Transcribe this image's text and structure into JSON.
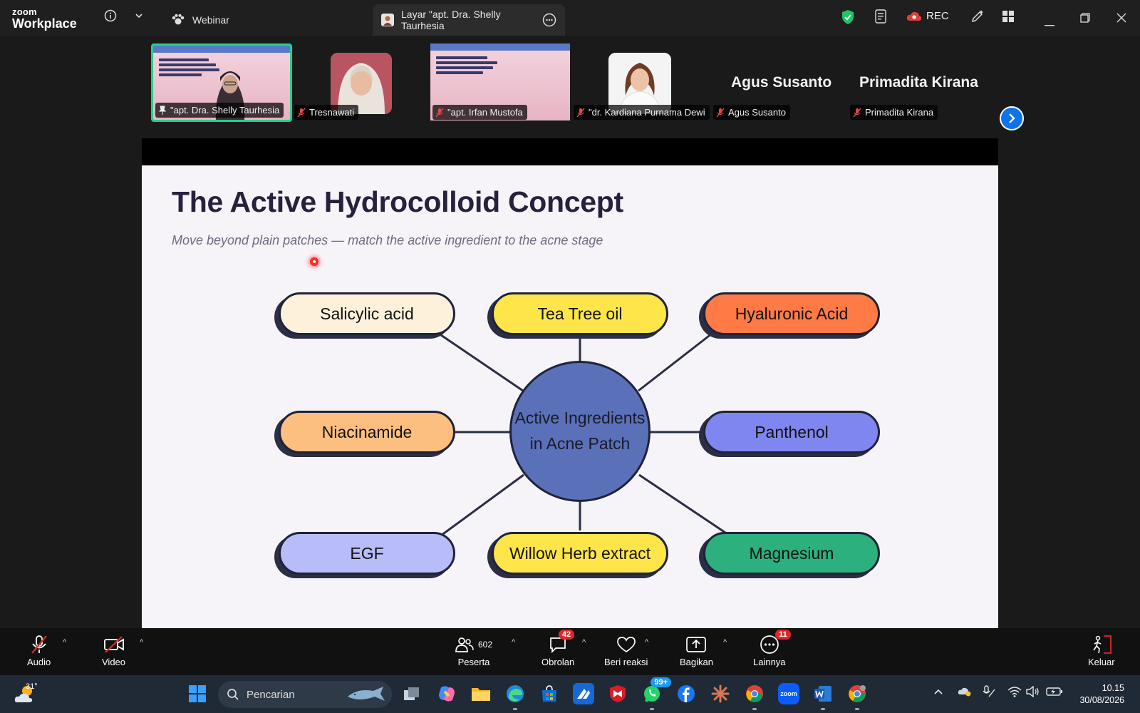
{
  "window": {
    "brand_line1": "zoom",
    "brand_line2": "Workplace",
    "tabs": [
      {
        "label": "Webinar"
      },
      {
        "label": "Layar \"apt. Dra. Shelly Taurhesia"
      }
    ],
    "rec_label": "REC"
  },
  "gallery": {
    "participants": [
      {
        "label": "\"apt. Dra. Shelly Taurhesia",
        "pinned": true,
        "muted": false
      },
      {
        "label": "Tresnawati",
        "muted": true
      },
      {
        "label": "\"apt. Irfan Mustofa",
        "muted": true
      },
      {
        "label": "\"dr. Kardiana Purnama Dewi",
        "muted": true
      },
      {
        "label": "Agus Susanto",
        "muted": true
      },
      {
        "label": "Primadita Kirana",
        "muted": true
      }
    ],
    "name_only": [
      "Agus Susanto",
      "Primadita Kirana"
    ]
  },
  "slide": {
    "title": "The Active Hydrocolloid Concept",
    "subtitle": "Move beyond plain patches — match the active ingredient to the acne stage",
    "hub": {
      "line1": "Active Ingredients",
      "line2": "in Acne Patch",
      "color": "#5a70b8"
    },
    "ingredients": [
      {
        "label": "Salicylic acid",
        "color": "#fdf1dc"
      },
      {
        "label": "Tea Tree oil",
        "color": "#fde54a"
      },
      {
        "label": "Hyaluronic Acid",
        "color": "#ff7a45"
      },
      {
        "label": "Niacinamide",
        "color": "#fdbf80"
      },
      {
        "label": "Panthenol",
        "color": "#7f86f0"
      },
      {
        "label": "EGF",
        "color": "#b8bcf8"
      },
      {
        "label": "Willow Herb extract",
        "color": "#fde54a"
      },
      {
        "label": "Magnesium",
        "color": "#2bb07e"
      }
    ]
  },
  "controls": {
    "audio": "Audio",
    "video": "Video",
    "participants": "Peserta",
    "participants_count": "602",
    "chat": "Obrolan",
    "chat_badge": "42",
    "react": "Beri reaksi",
    "share": "Bagikan",
    "more": "Lainnya",
    "more_badge": "11",
    "leave": "Keluar"
  },
  "taskbar": {
    "temperature": "31°",
    "search_placeholder": "Pencarian",
    "whatsapp_badge": "99+",
    "time": "10.15",
    "date": "30/08/2026"
  }
}
